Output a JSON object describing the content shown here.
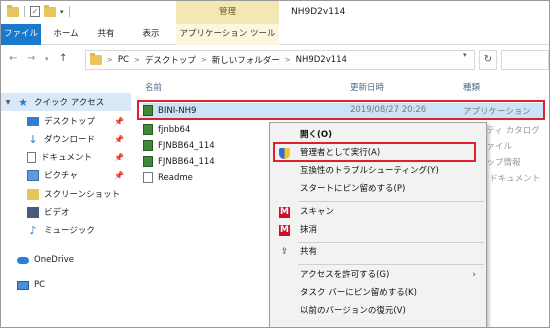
{
  "window": {
    "title": "NH9D2v114",
    "context_tab_title": "管理"
  },
  "ribbon": {
    "tabs": [
      "ファイル",
      "ホーム",
      "共有",
      "表示",
      "アプリケーション ツール"
    ]
  },
  "address": {
    "segments": [
      "PC",
      "デスクトップ",
      "新しいフォルダー",
      "NH9D2v114"
    ],
    "separator": ">"
  },
  "navpane": {
    "items": [
      {
        "label": "クイック アクセス",
        "icon": "star-icon"
      },
      {
        "label": "デスクトップ",
        "icon": "desktop-icon"
      },
      {
        "label": "ダウンロード",
        "icon": "download-icon"
      },
      {
        "label": "ドキュメント",
        "icon": "document-icon"
      },
      {
        "label": "ピクチャ",
        "icon": "pictures-icon"
      },
      {
        "label": "スクリーンショット",
        "icon": "folder-icon"
      },
      {
        "label": "ビデオ",
        "icon": "video-icon"
      },
      {
        "label": "ミュージック",
        "icon": "music-icon"
      },
      {
        "label": "OneDrive",
        "icon": "cloud-icon"
      },
      {
        "label": "PC",
        "icon": "pc-icon"
      }
    ]
  },
  "content": {
    "columns": {
      "name": "名前",
      "date": "更新日時",
      "type": "種類"
    },
    "files": [
      {
        "name": "BINI-NH9",
        "date": "2019/08/27 20:26",
        "type": "アプリケーション",
        "icon": "exe-icon"
      },
      {
        "name": "fjnbb64",
        "icon": "exe-icon"
      },
      {
        "name": "FJNBB64_114",
        "icon": "exe-icon"
      },
      {
        "name": "FJNBB64_114",
        "icon": "exe-icon"
      },
      {
        "name": "Readme",
        "icon": "text-file-icon"
      }
    ],
    "type_column_partial": [
      "リティ カタログ",
      "ファイル",
      "アップ情報",
      "ト ドキュメント"
    ]
  },
  "context_menu": {
    "items": [
      {
        "label": "開く(O)"
      },
      {
        "label": "管理者として実行(A)",
        "icon": "uac-shield-icon"
      },
      {
        "label": "互換性のトラブルシューティング(Y)"
      },
      {
        "label": "スタートにピン留めする(P)"
      },
      {
        "label": "スキャン",
        "icon": "mcafee-icon"
      },
      {
        "label": "抹消",
        "icon": "mcafee-icon"
      },
      {
        "label": "共有",
        "icon": "share-icon"
      },
      {
        "label": "アクセスを許可する(G)",
        "submenu": true
      },
      {
        "label": "タスク バーにピン留めする(K)"
      },
      {
        "label": "以前のバージョンの復元(V)"
      }
    ]
  },
  "colors": {
    "file_tab": "#1979ca",
    "selection": "#cce4f7",
    "highlight_box": "#e0202a",
    "context_tab": "#f3e8b5"
  }
}
